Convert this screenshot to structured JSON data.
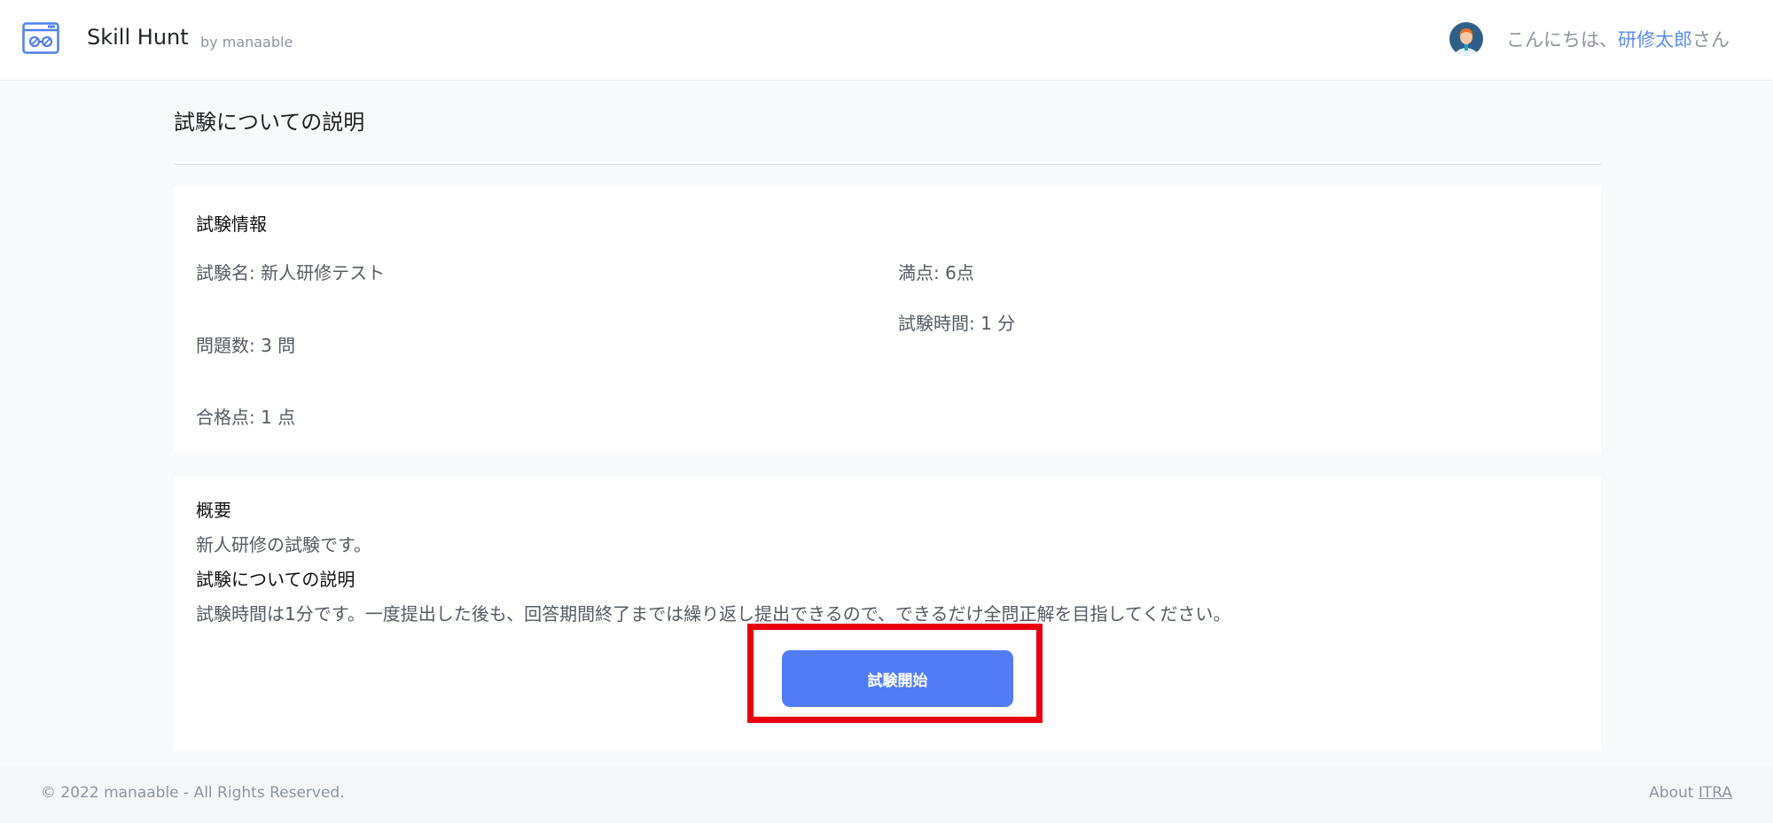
{
  "header": {
    "brand": "Skill Hunt",
    "brand_sub": "by manaable",
    "greeting_prefix": "こんにちは、",
    "user_name": "研修太郎",
    "greeting_suffix": "さん",
    "logo_icon": "browser-window-icon",
    "avatar_icon": "user-avatar-icon"
  },
  "page": {
    "title": "試験についての説明"
  },
  "info": {
    "heading": "試験情報",
    "exam_name": "試験名: 新人研修テスト",
    "question_count": "問題数: 3 問",
    "passing_score": "合格点: 1 点",
    "full_score": "満点: 6点",
    "exam_time": "試験時間: 1 分"
  },
  "overview": {
    "heading": "概要",
    "text": "新人研修の試験です。",
    "explanation_heading": "試験についての説明",
    "explanation_text": "試験時間は1分です。一度提出した後も、回答期間終了までは繰り返し提出できるので、できるだけ全問正解を目指してください。",
    "start_button": "試験開始"
  },
  "footer": {
    "copyright": "© 2022 manaable - All Rights Reserved.",
    "about_prefix": "About ",
    "about_link": "ITRA"
  },
  "colors": {
    "accent": "#527cf7",
    "highlight_border": "#e8000f",
    "user_link": "#5b8def",
    "background": "#f8f9fb"
  }
}
